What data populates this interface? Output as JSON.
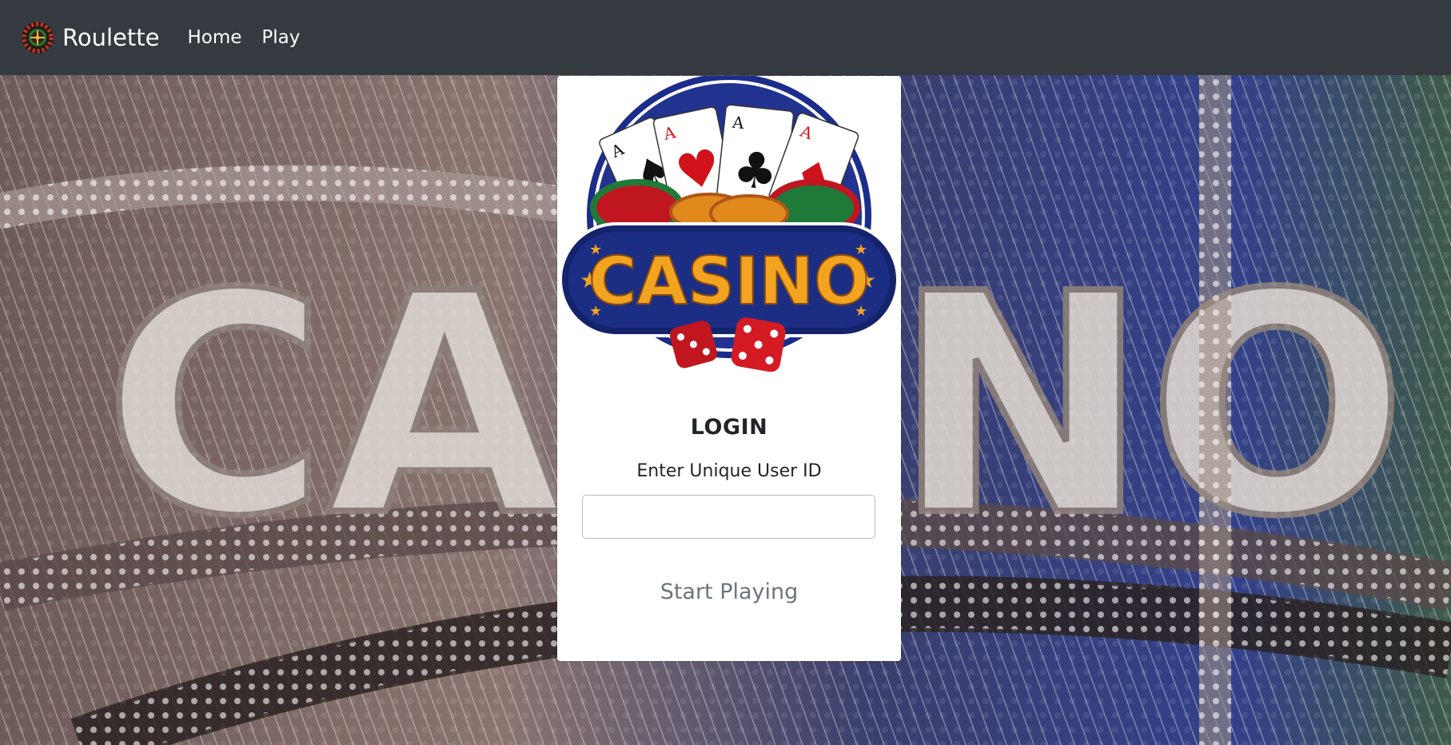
{
  "navbar": {
    "brand_text": "Roulette",
    "links": [
      {
        "label": "Home"
      },
      {
        "label": "Play"
      }
    ],
    "background": "#343a40"
  },
  "background_image": {
    "sign_text": "CASINO"
  },
  "login_card": {
    "logo_text": "CASINO",
    "title": "LOGIN",
    "user_id_label": "Enter Unique User ID",
    "user_id_value": "",
    "start_button_label": "Start Playing"
  },
  "colors": {
    "navbar_bg": "#343a40",
    "card_bg": "#ffffff",
    "button_text": "#6c757d",
    "logo_navy": "#14236b",
    "logo_gold": "#f2a421",
    "dice_red": "#c0161f"
  }
}
